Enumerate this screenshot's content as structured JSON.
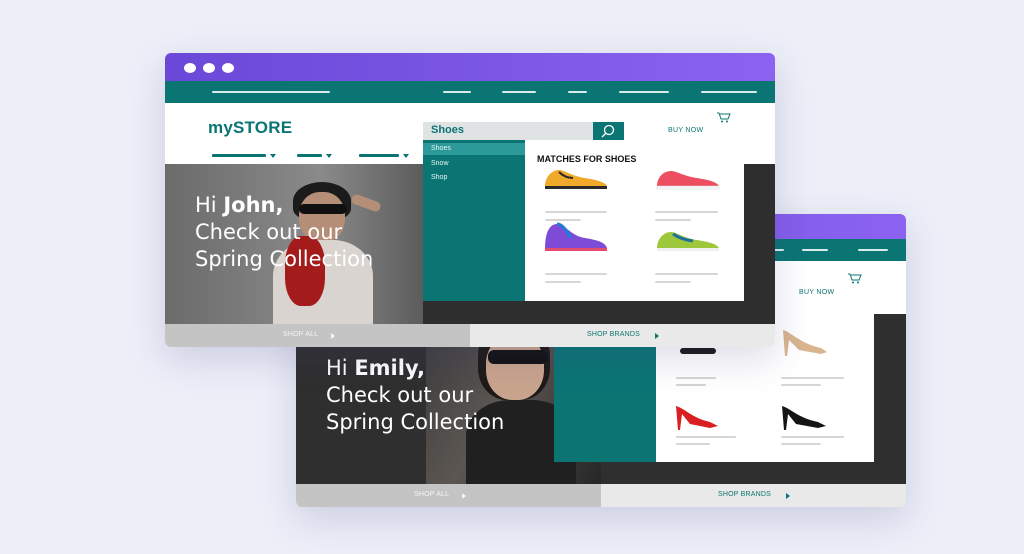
{
  "front": {
    "logo_my": "my",
    "logo_store": "STORE",
    "buy_now": "BUY NOW",
    "search": {
      "value": "Shoes"
    },
    "dropdown": {
      "suggestions": [
        "Shoes",
        "Snow",
        "Shop"
      ],
      "matches_title": "MATCHES FOR SHOES"
    },
    "hero": {
      "greeting": "Hi",
      "name": "John,",
      "line2": "Check out our",
      "line3": "Spring Collection"
    },
    "footer": {
      "shop_all": "SHOP ALL",
      "shop_brands": "SHOP BRANDS"
    }
  },
  "back": {
    "buy_now": "BUY NOW",
    "hero": {
      "greeting": "Hi",
      "name": "Emily,",
      "line2": "Check out our",
      "line3": "Spring Collection"
    },
    "footer": {
      "shop_all": "SHOP ALL",
      "shop_brands": "SHOP BRANDS"
    }
  },
  "colors": {
    "teal": "#0b7574",
    "purple": "#7a55e6",
    "bg": "#eceef8"
  },
  "icons": [
    "search-icon",
    "cart-icon",
    "caret-down-icon",
    "play-triangle-icon"
  ]
}
